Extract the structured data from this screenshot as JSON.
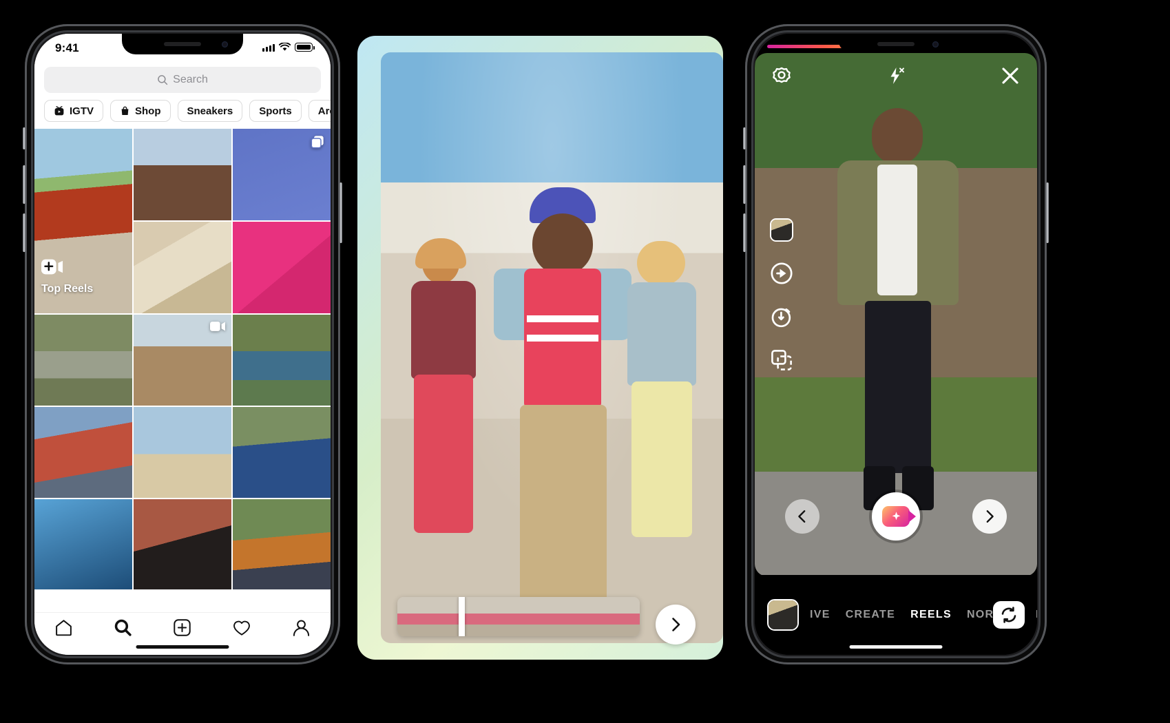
{
  "scene": {
    "background": "#000000",
    "device_count": 3
  },
  "phone1": {
    "name": "instagram-explore",
    "status_bar": {
      "time": "9:41",
      "signal_icon": "cellular-bars-icon",
      "wifi_icon": "wifi-icon",
      "battery_icon": "battery-full-icon"
    },
    "search": {
      "placeholder": "Search",
      "icon": "search-icon"
    },
    "chips": [
      {
        "label": "IGTV",
        "icon": "igtv-icon"
      },
      {
        "label": "Shop",
        "icon": "shopping-bag-icon"
      },
      {
        "label": "Sneakers",
        "icon": ""
      },
      {
        "label": "Sports",
        "icon": ""
      },
      {
        "label": "Architecture",
        "icon": ""
      }
    ],
    "grid": [
      {
        "name": "post-house-soccer",
        "badge": "",
        "tall": true,
        "style": "ph-house",
        "overlay_label": "Top Reels",
        "overlay_icon": "reels-camera-icon"
      },
      {
        "name": "post-man-portrait",
        "badge": "",
        "tall": false,
        "style": "ph-man"
      },
      {
        "name": "post-basketball",
        "badge": "carousel-icon",
        "tall": false,
        "style": "ph-ball"
      },
      {
        "name": "post-food-table",
        "badge": "",
        "tall": false,
        "style": "ph-food"
      },
      {
        "name": "post-pink-sunglasses",
        "badge": "",
        "tall": false,
        "style": "ph-pink"
      },
      {
        "name": "post-roadside",
        "badge": "",
        "tall": false,
        "style": "ph-road"
      },
      {
        "name": "post-selfie-smile",
        "badge": "video-icon",
        "tall": false,
        "style": "ph-selfie"
      },
      {
        "name": "post-river-hug",
        "badge": "",
        "tall": false,
        "style": "ph-river"
      },
      {
        "name": "post-friends-red",
        "badge": "",
        "tall": false,
        "style": "ph-friends"
      },
      {
        "name": "post-house-roof",
        "badge": "",
        "tall": false,
        "style": "ph-roof"
      },
      {
        "name": "post-girl-blue",
        "badge": "",
        "tall": false,
        "style": "ph-girl"
      },
      {
        "name": "post-blue-shadows",
        "badge": "",
        "tall": false,
        "style": "ph-shadow"
      },
      {
        "name": "post-hijab-portrait",
        "badge": "",
        "tall": false,
        "style": "ph-hijab"
      },
      {
        "name": "post-two-women",
        "badge": "",
        "tall": false,
        "style": "ph-two"
      }
    ],
    "tabbar": [
      {
        "name": "tab-home",
        "icon": "home-icon",
        "active": false
      },
      {
        "name": "tab-search",
        "icon": "search-icon",
        "active": true
      },
      {
        "name": "tab-create",
        "icon": "plus-square-icon",
        "active": false
      },
      {
        "name": "tab-activity",
        "icon": "heart-icon",
        "active": false
      },
      {
        "name": "tab-profile",
        "icon": "person-icon",
        "active": false
      }
    ]
  },
  "phone2": {
    "name": "reels-editor",
    "video": {
      "name": "reels-preview-video",
      "description": "three dancers outdoors"
    },
    "timeline": {
      "name": "clip-timeline",
      "frame_count": 7,
      "playhead_position_pct": 25
    },
    "next_button": {
      "name": "next-button",
      "icon": "chevron-right-icon"
    }
  },
  "phone3": {
    "name": "reels-camera",
    "recording_progress_pct": 29,
    "top_bar": [
      {
        "name": "camera-settings-button",
        "icon": "settings-gear-icon"
      },
      {
        "name": "flash-toggle-button",
        "icon": "flash-off-icon"
      },
      {
        "name": "close-camera-button",
        "icon": "close-x-icon"
      }
    ],
    "tools": [
      {
        "name": "effects-button",
        "icon": "effects-thumbnail-icon"
      },
      {
        "name": "speed-button",
        "icon": "speed-play-icon"
      },
      {
        "name": "timer-button",
        "icon": "timer-icon"
      },
      {
        "name": "align-button",
        "icon": "align-layers-icon"
      }
    ],
    "shutter": {
      "name": "record-button",
      "icon": "reels-camera-icon"
    },
    "nav": [
      {
        "name": "previous-effect-button",
        "icon": "chevron-left-icon"
      },
      {
        "name": "next-effect-button",
        "icon": "chevron-right-icon"
      }
    ],
    "mode_bar": {
      "gallery_thumb": {
        "name": "gallery-thumbnail",
        "icon": "photo-thumbnail-icon"
      },
      "modes": [
        {
          "label": "IVE",
          "active": false
        },
        {
          "label": "CREATE",
          "active": false
        },
        {
          "label": "REELS",
          "active": true
        },
        {
          "label": "NORMAL",
          "active": false
        },
        {
          "label": "BO",
          "active": false
        }
      ],
      "flip_button": {
        "name": "flip-camera-button",
        "icon": "flip-camera-icon"
      }
    }
  },
  "colors": {
    "ig_gradient_start": "#fdc468",
    "ig_gradient_mid": "#f95d7a",
    "ig_gradient_end": "#d6249f",
    "chip_border": "#dbdbdb",
    "search_bg": "#efeff0",
    "placeholder": "#8e8e93",
    "mode_inactive": "#9a9a9a",
    "mode_active": "#ffffff"
  }
}
